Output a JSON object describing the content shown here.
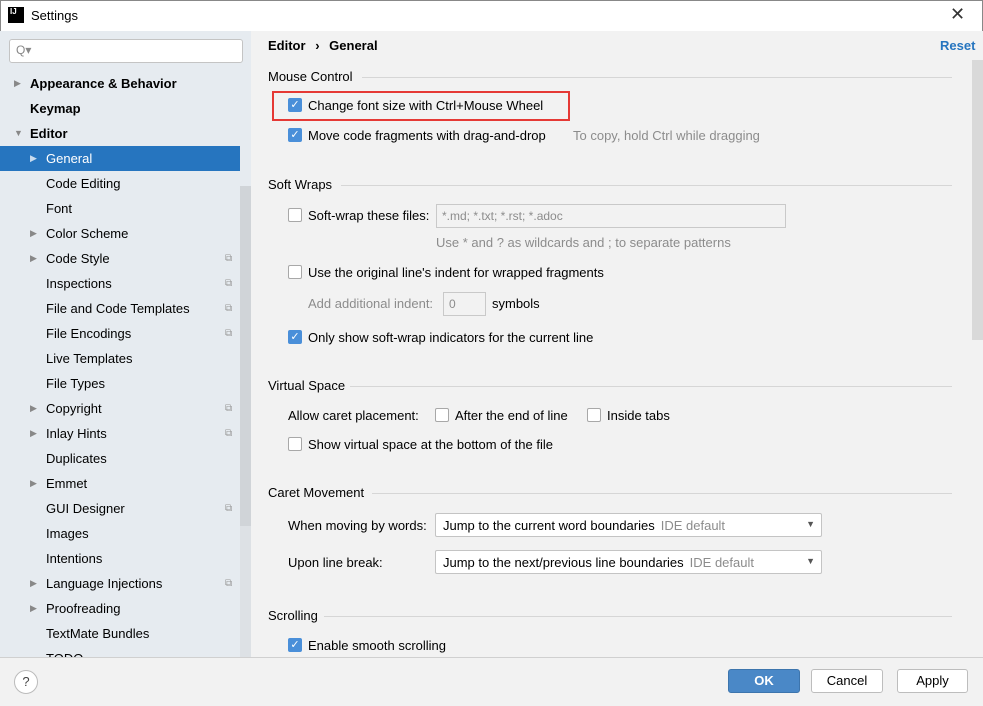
{
  "window": {
    "title": "Settings",
    "logo": "IJ",
    "close_icon": "close-icon"
  },
  "sidebar": {
    "search_placeholder": "Q▾",
    "items": [
      {
        "label": "Appearance & Behavior",
        "level": 0,
        "bold": true,
        "arrow": "right"
      },
      {
        "label": "Keymap",
        "level": 0,
        "bold": true
      },
      {
        "label": "Editor",
        "level": 0,
        "bold": true,
        "arrow": "down"
      },
      {
        "label": "General",
        "level": 1,
        "arrow": "right",
        "selected": true
      },
      {
        "label": "Code Editing",
        "level": 1
      },
      {
        "label": "Font",
        "level": 1
      },
      {
        "label": "Color Scheme",
        "level": 1,
        "arrow": "right"
      },
      {
        "label": "Code Style",
        "level": 1,
        "arrow": "right",
        "copy": true
      },
      {
        "label": "Inspections",
        "level": 1,
        "copy": true
      },
      {
        "label": "File and Code Templates",
        "level": 1,
        "copy": true
      },
      {
        "label": "File Encodings",
        "level": 1,
        "copy": true
      },
      {
        "label": "Live Templates",
        "level": 1
      },
      {
        "label": "File Types",
        "level": 1
      },
      {
        "label": "Copyright",
        "level": 1,
        "arrow": "right",
        "copy": true
      },
      {
        "label": "Inlay Hints",
        "level": 1,
        "arrow": "right",
        "copy": true
      },
      {
        "label": "Duplicates",
        "level": 1
      },
      {
        "label": "Emmet",
        "level": 1,
        "arrow": "right"
      },
      {
        "label": "GUI Designer",
        "level": 1,
        "copy": true
      },
      {
        "label": "Images",
        "level": 1
      },
      {
        "label": "Intentions",
        "level": 1
      },
      {
        "label": "Language Injections",
        "level": 1,
        "arrow": "right",
        "copy": true
      },
      {
        "label": "Proofreading",
        "level": 1,
        "arrow": "right"
      },
      {
        "label": "TextMate Bundles",
        "level": 1
      },
      {
        "label": "TODO",
        "level": 1
      }
    ]
  },
  "breadcrumb": {
    "parent": "Editor",
    "sep": "›",
    "current": "General"
  },
  "reset_label": "Reset",
  "mouse": {
    "title": "Mouse Control",
    "change_font": "Change font size with Ctrl+Mouse Wheel",
    "change_font_checked": true,
    "drag_drop": "Move code fragments with drag-and-drop",
    "drag_drop_checked": true,
    "drag_hint": "To copy, hold Ctrl while dragging"
  },
  "softwraps": {
    "title": "Soft Wraps",
    "files_label": "Soft-wrap these files:",
    "files_checked": false,
    "files_value": "*.md; *.txt; *.rst; *.adoc",
    "files_hint": "Use * and ? as wildcards and ; to separate patterns",
    "indent_label": "Use the original line's indent for wrapped fragments",
    "indent_checked": false,
    "additional_label": "Add additional indent:",
    "additional_value": "0",
    "symbols": "symbols",
    "indicators_label": "Only show soft-wrap indicators for the current line",
    "indicators_checked": true
  },
  "virtual": {
    "title": "Virtual Space",
    "caret_label": "Allow caret placement:",
    "after_end": "After the end of line",
    "after_end_checked": false,
    "inside_tabs": "Inside tabs",
    "inside_tabs_checked": false,
    "show_bottom": "Show virtual space at the bottom of the file",
    "show_bottom_checked": false
  },
  "caret": {
    "title": "Caret Movement",
    "words_label": "When moving by words:",
    "words_value": "Jump to the current word boundaries",
    "words_hint": "IDE default",
    "break_label": "Upon line break:",
    "break_value": "Jump to the next/previous line boundaries",
    "break_hint": "IDE default"
  },
  "scrolling": {
    "title": "Scrolling",
    "smooth": "Enable smooth scrolling",
    "smooth_checked": true
  },
  "buttons": {
    "help": "?",
    "ok": "OK",
    "cancel": "Cancel",
    "apply": "Apply"
  },
  "colors": {
    "accent": "#2675bf",
    "ok": "#4a88c7",
    "highlight": "#e53935"
  }
}
